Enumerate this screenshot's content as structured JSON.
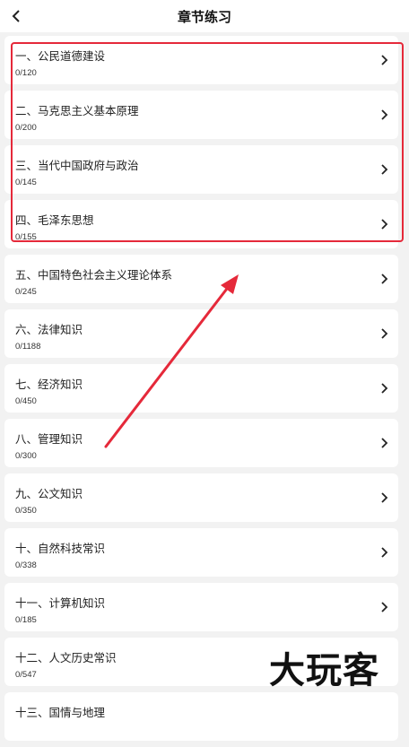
{
  "header": {
    "title": "章节练习"
  },
  "chapters": [
    {
      "name": "一、公民道德建设",
      "count": "0/120"
    },
    {
      "name": "二、马克思主义基本原理",
      "count": "0/200"
    },
    {
      "name": "三、当代中国政府与政治",
      "count": "0/145"
    },
    {
      "name": "四、毛泽东思想",
      "count": "0/155"
    },
    {
      "name": "五、中国特色社会主义理论体系",
      "count": "0/245"
    },
    {
      "name": "六、法律知识",
      "count": "0/1188"
    },
    {
      "name": "七、经济知识",
      "count": "0/450"
    },
    {
      "name": "八、管理知识",
      "count": "0/300"
    },
    {
      "name": "九、公文知识",
      "count": "0/350"
    },
    {
      "name": "十、自然科技常识",
      "count": "0/338"
    },
    {
      "name": "十一、计算机知识",
      "count": "0/185"
    },
    {
      "name": "十二、人文历史常识",
      "count": "0/547"
    },
    {
      "name": "十三、国情与地理",
      "count": ""
    }
  ],
  "watermark": "大玩客",
  "colors": {
    "annotation": "#e5293a",
    "background": "#f2f2f2",
    "card": "#ffffff"
  },
  "icons": {
    "back": "chevron-left-icon",
    "row": "chevron-right-icon"
  }
}
